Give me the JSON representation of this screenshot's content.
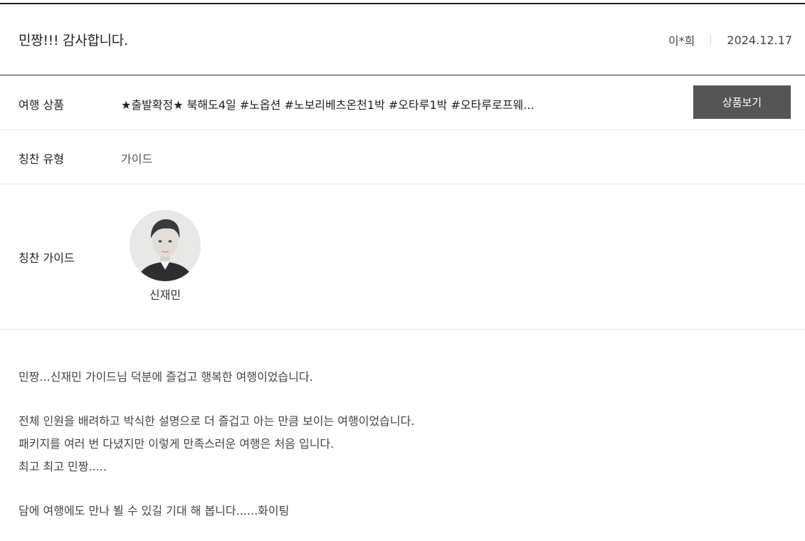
{
  "review": {
    "title": "민짱!!! 감사합니다.",
    "author": "이*희",
    "date": "2024.12.17"
  },
  "product": {
    "label": "여행 상품",
    "name": "★출발확정★ 북해도4일 #노옵션 #노보리베츠온천1박 #오타루1박 #오타루로프웨...",
    "button_label": "상품보기"
  },
  "praise_type": {
    "label": "칭찬 유형",
    "value": "가이드"
  },
  "praised_guide": {
    "label": "칭찬 가이드",
    "name": "신재민"
  },
  "body": {
    "paragraphs": [
      [
        "민짱...신재민 가이드님 덕분에 즐겁고 행복한 여행이었습니다."
      ],
      [
        "전체 인원을 배려하고 박식한 설명으로 더 즐겁고 아는 만큼 보이는 여행이었습니다.",
        "패키지를 여러 번 다녔지만 이렇게 만족스러운 여행은 처음 입니다.",
        "최고 최고 민짱....."
      ],
      [
        "담에 여행에도 만나 뵐 수 있길 기대 해 봅니다......화이팅"
      ]
    ]
  },
  "colors": {
    "button_bg": "#555555",
    "top_rule": "#222222",
    "row_divider": "#e3e3e3"
  }
}
